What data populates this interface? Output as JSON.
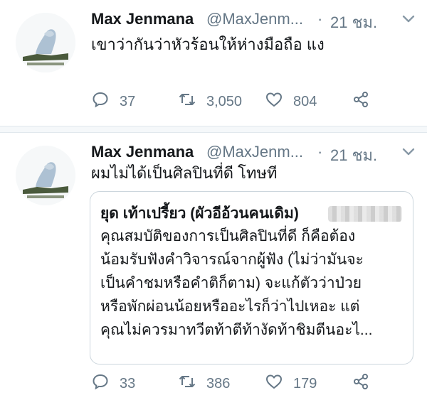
{
  "tweets": [
    {
      "author_name": "Max Jenmana",
      "author_handle": "@MaxJenm...",
      "separator": "·",
      "time": "21 ชม.",
      "text": "เขาว่ากันว่าหัวร้อนให้ห่างมือถือ แง",
      "reply_count": "37",
      "retweet_count": "3,050",
      "like_count": "804"
    },
    {
      "author_name": "Max Jenmana",
      "author_handle": "@MaxJenm...",
      "separator": "·",
      "time": "21 ชม.",
      "text": "ผมไม่ได้เป็นศิลปินที่ดี โทษที",
      "quote": {
        "author": "ยุด เท้าเปรี้ยว (ผัวอีอ้วนคนเดิม)",
        "lines": [
          "คุณสมบัติของการเป็นศิลปินที่ดี ก็คือต้อง",
          "น้อมรับฟังคำวิจารณ์จากผู้ฟัง (ไม่ว่ามันจะ",
          "เป็นคำชมหรือคำติก็ตาม) จะแก้ตัวว่าป่วย",
          "หรือพักผ่อนน้อยหรืออะไรก็ว่าไปเหอะ แต่",
          "คุณไม่ควรมาทวีตท้าตีท้างัดท้าชิมตีนอะไ..."
        ]
      },
      "reply_count": "33",
      "retweet_count": "386",
      "like_count": "179"
    }
  ],
  "icons": {
    "reply": "reply-icon",
    "retweet": "retweet-icon",
    "like": "heart-icon",
    "share": "share-icon",
    "caret": "chevron-down-icon"
  },
  "colors": {
    "text": "#14171a",
    "secondary": "#657786",
    "border": "#e1e8ed"
  }
}
